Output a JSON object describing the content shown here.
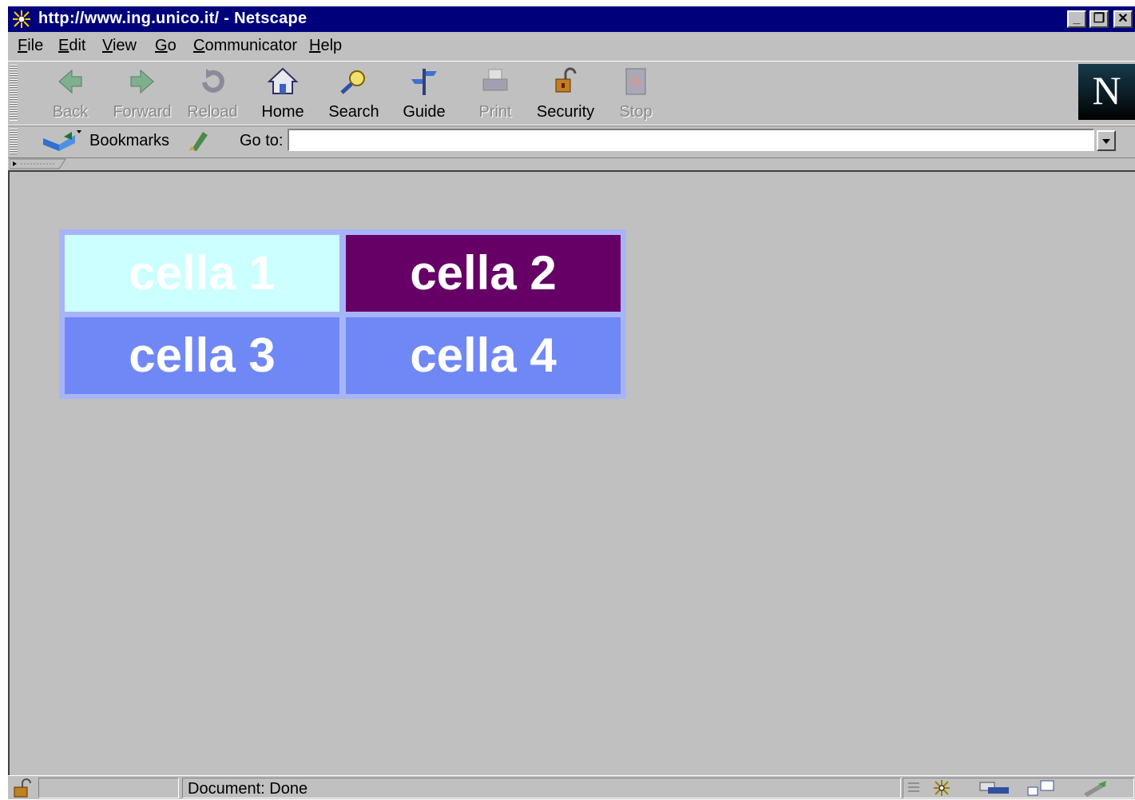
{
  "window": {
    "title": "http://www.ing.unico.it/ - Netscape",
    "controls": {
      "minimize": "_",
      "maximize": "❐",
      "close": "✕"
    }
  },
  "menu": [
    {
      "label": "File",
      "mnemonic": "F",
      "rest": "ile"
    },
    {
      "label": "Edit",
      "mnemonic": "E",
      "rest": "dit"
    },
    {
      "label": "View",
      "mnemonic": "V",
      "rest": "iew"
    },
    {
      "label": "Go",
      "mnemonic": "G",
      "rest": "o"
    },
    {
      "label": "Communicator",
      "mnemonic": "C",
      "rest": "ommunicator"
    },
    {
      "label": "Help",
      "mnemonic": "H",
      "rest": "elp"
    }
  ],
  "toolbar": {
    "buttons": [
      {
        "label": "Back",
        "icon": "back-icon",
        "enabled": false
      },
      {
        "label": "Forward",
        "icon": "forward-icon",
        "enabled": false
      },
      {
        "label": "Reload",
        "icon": "reload-icon",
        "enabled": false
      },
      {
        "label": "Home",
        "icon": "home-icon",
        "enabled": true
      },
      {
        "label": "Search",
        "icon": "search-icon",
        "enabled": true
      },
      {
        "label": "Guide",
        "icon": "guide-icon",
        "enabled": true
      },
      {
        "label": "Print",
        "icon": "print-icon",
        "enabled": false
      },
      {
        "label": "Security",
        "icon": "security-icon",
        "enabled": true
      },
      {
        "label": "Stop",
        "icon": "stop-icon",
        "enabled": false
      }
    ],
    "logo": "N"
  },
  "location": {
    "bookmarks_label": "Bookmarks",
    "goto_label": "Go to:",
    "url_value": ""
  },
  "content": {
    "cells": [
      {
        "text": "cella 1",
        "bg": "#ccffff"
      },
      {
        "text": "cella 2",
        "bg": "#660066"
      },
      {
        "text": "cella 3",
        "bg": "#7088f5"
      },
      {
        "text": "cella 4",
        "bg": "#7088f5"
      }
    ],
    "table_border_color": "#a7b4f8"
  },
  "status": {
    "text": "Document: Done"
  },
  "colors": {
    "titlebar": "#00007b",
    "chrome": "#c0c0c0"
  }
}
